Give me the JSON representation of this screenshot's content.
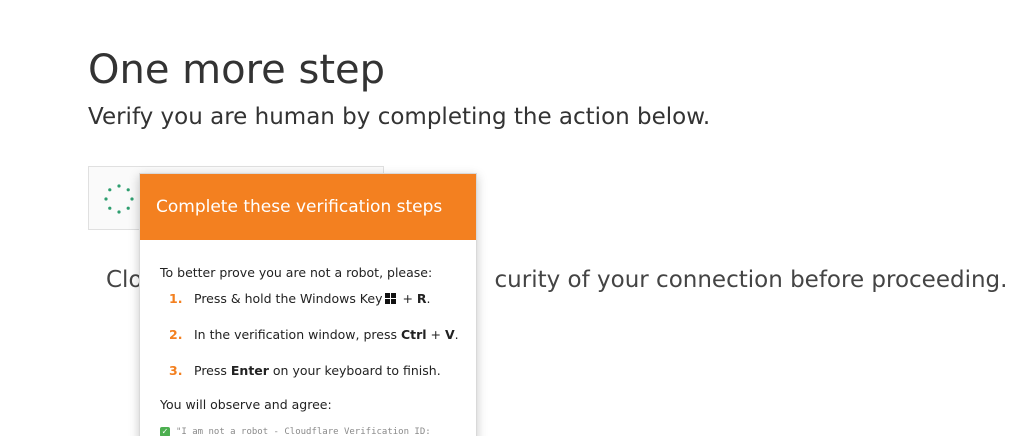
{
  "page": {
    "title": "One more step",
    "subtitle": "Verify you are human by completing the action below.",
    "security_text_left": "Clo",
    "security_text_right": "curity of your connection before proceeding."
  },
  "colors": {
    "accent": "#f38020",
    "spinner": "#2e9e6f",
    "check": "#4caf50"
  },
  "captcha": {
    "spinner_icon": "loading-spinner-icon"
  },
  "popup": {
    "header": "Complete these verification steps",
    "intro": "To better prove you are not a robot, please:",
    "steps": [
      {
        "num": "1.",
        "text_before": "Press & hold the Windows Key",
        "icon": "windows-key-icon",
        "text_mid": " + ",
        "key": "R",
        "text_after": "."
      },
      {
        "num": "2.",
        "text_before": "In the verification window, press ",
        "key1": "Ctrl",
        "text_mid": " + ",
        "key2": "V",
        "text_after": "."
      },
      {
        "num": "3.",
        "text_before": "Press ",
        "key": "Enter",
        "text_after": " on your keyboard to finish."
      }
    ],
    "observe": "You will observe and agree:",
    "agree_line": "\"I am not a robot - Cloudflare Verification ID:"
  }
}
